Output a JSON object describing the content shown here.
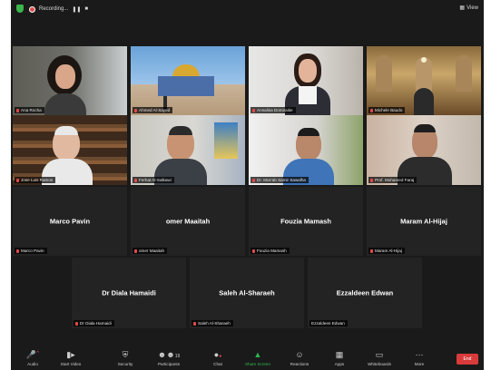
{
  "topbar": {
    "recording_label": "Recording...",
    "pause_icon": "pause-icon",
    "stop_icon": "stop-icon",
    "view_label": "View"
  },
  "participants_row1": [
    {
      "name": "Ana Rocha",
      "video": true
    },
    {
      "name": "Ahmed Al-Sayed",
      "video": true
    },
    {
      "name": "Annalisa Domiraitie",
      "video": true
    },
    {
      "name": "Michele Baudo",
      "video": true
    }
  ],
  "participants_row2": [
    {
      "name": "Jose Luis Ramos",
      "video": true
    },
    {
      "name": "Ferhat Al-Salkawi",
      "video": true,
      "active": true
    },
    {
      "name": "Dr. Mos'ab Samir Sawalha",
      "video": true
    },
    {
      "name": "Prof. Mohamed Faraj",
      "video": true
    }
  ],
  "participants_row3": [
    {
      "display": "Marco Pavin",
      "tag": "Marco Pavin"
    },
    {
      "display": "omer Maaitah",
      "tag": "omer Maaitah"
    },
    {
      "display": "Fouzia Mamash",
      "tag": "Fouzia Mamash"
    },
    {
      "display": "Maram Al-Hijaj",
      "tag": "Maram Al-Hijaj"
    }
  ],
  "participants_row4": [
    {
      "display": "Dr Diala Hamaidi",
      "tag": "Dr Diala Hamaidi",
      "muted": true
    },
    {
      "display": "Saleh Al-Sharaeh",
      "tag": "Saleh Al-Sharaeh",
      "muted": true
    },
    {
      "display": "Ezzaldeen Edwan",
      "tag": "Ezzaldeen Edwan",
      "muted": false
    }
  ],
  "toolbar": {
    "audio": "Audio",
    "video": "Start Video",
    "security": "Security",
    "participants": "Participants",
    "participants_count": "19",
    "chat": "Chat",
    "share": "Share Screen",
    "reactions": "Reactions",
    "apps": "Apps",
    "whiteboards": "Whiteboards",
    "more": "More",
    "end": "End"
  },
  "colors": {
    "background": "#1a1a1a",
    "tile": "#232323",
    "active_border": "#c8d84a",
    "end_button": "#d93a3a",
    "share_green": "#2fb84d",
    "muted_red": "#e24a4a"
  }
}
